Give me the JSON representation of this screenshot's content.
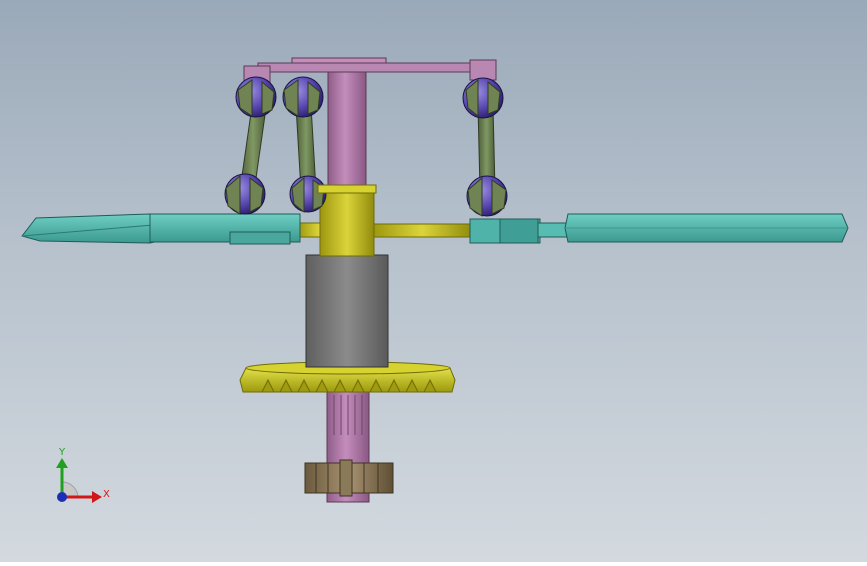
{
  "triad": {
    "x_label": "X",
    "y_label": "Y",
    "colors": {
      "x": "#d01818",
      "y": "#20a020",
      "z": "#1a2fb8"
    }
  },
  "model": {
    "colors": {
      "shaft": "#b07aa7",
      "shaft_dark": "#7d4f78",
      "hub": "#c9c21a",
      "hub_dark": "#7f7b0c",
      "blade": "#4fb3a9",
      "blade_dark": "#2c7b74",
      "link": "#6f8452",
      "joint": "#4c3f9b",
      "housing": "#767676",
      "gear": "#cfcc1c"
    }
  }
}
